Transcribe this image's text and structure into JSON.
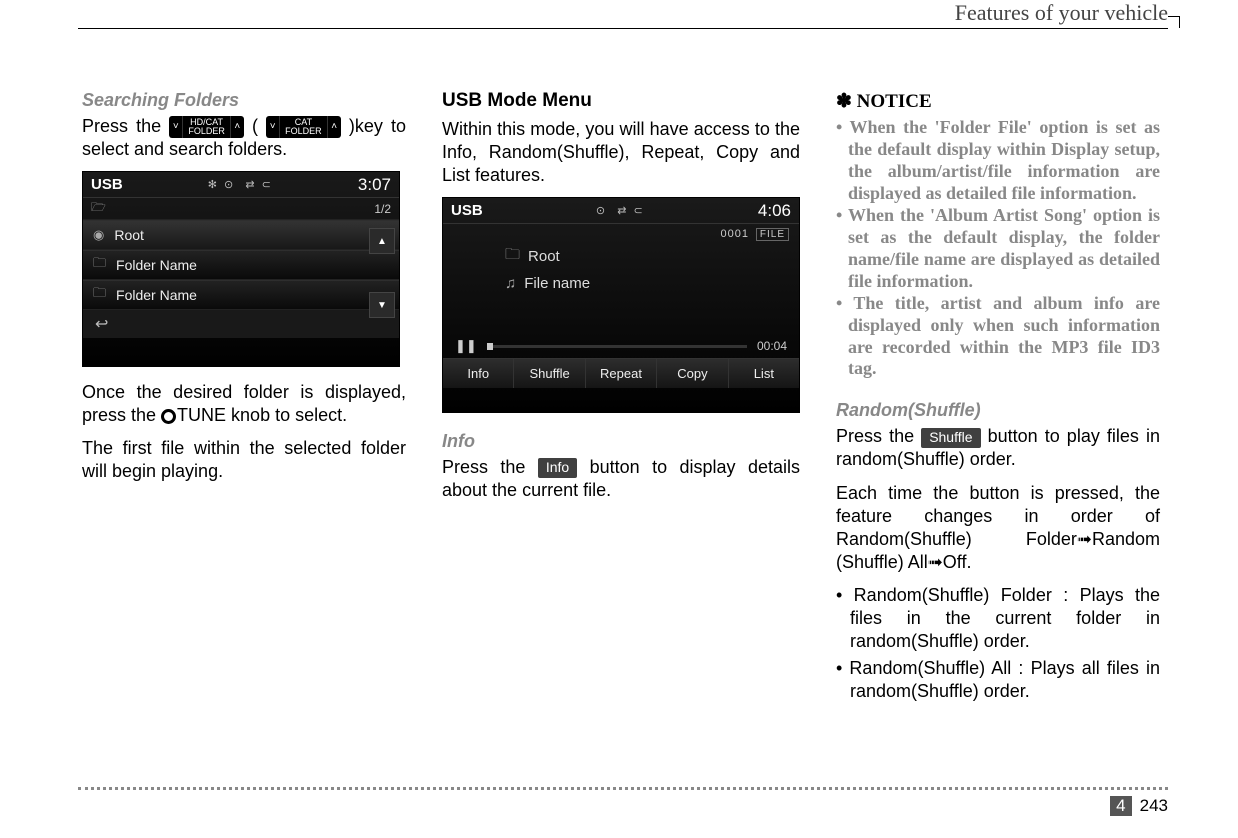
{
  "header": {
    "title": "Features of your vehicle"
  },
  "col1": {
    "heading": "Searching Folders",
    "press_prefix": "Press the ",
    "press_suffix": "key to select and search folders.",
    "key1_top": "HD/CAT",
    "key1_bot": "FOLDER",
    "paren_open": "(",
    "key2_top": "CAT",
    "key2_bot": "FOLDER",
    "paren_close": ")",
    "screen": {
      "label": "USB",
      "time": "3:07",
      "counter": "1/2",
      "row1": "Root",
      "row2": "Folder Name",
      "row3": "Folder Name",
      "back": "↩"
    },
    "para2a": "Once the desired folder is displayed, press the ",
    "para2b": "TUNE knob to select.",
    "para3": "The first file within the selected folder will begin playing."
  },
  "col2": {
    "heading": "USB Mode Menu",
    "intro": "Within this mode, you will have access to the Info, Random(Shuffle), Repeat, Copy and List features.",
    "screen": {
      "label": "USB",
      "time": "4:06",
      "file_tag": "FILE",
      "file_no": "0001",
      "root": "Root",
      "fname": "File name",
      "elapsed": "00:04",
      "soft": [
        "Info",
        "Shuffle",
        "Repeat",
        "Copy",
        "List"
      ]
    },
    "info_head": "Info",
    "info_pre": "Press the ",
    "info_btn": "Info",
    "info_post": " button to display details about the current file."
  },
  "col3": {
    "notice_star": "✽",
    "notice": "NOTICE",
    "b1": "• When the 'Folder File' option is set as the default display within Display setup, the album/artist/file information are displayed as detailed file information.",
    "b2": "• When the 'Album Artist Song' option is set as the default display, the folder name/file name are displayed as detailed file information.",
    "b3": "• The title, artist and album info are displayed only when such information are recorded within the MP3 file ID3 tag.",
    "rand_head": "Random(Shuffle)",
    "rand_pre": "Press the ",
    "rand_btn": "Shuffle",
    "rand_post": " button to play files in random(Shuffle) order.",
    "rand_para2": "Each time the button is pressed, the feature changes in order of Random(Shuffle) Folder➟Random (Shuffle) All➟Off.",
    "rb1": "• Random(Shuffle) Folder : Plays the files in the current folder in random(Shuffle) order.",
    "rb2": "• Random(Shuffle) All : Plays all files in random(Shuffle) order."
  },
  "footer": {
    "chapter": "4",
    "page": "243"
  }
}
